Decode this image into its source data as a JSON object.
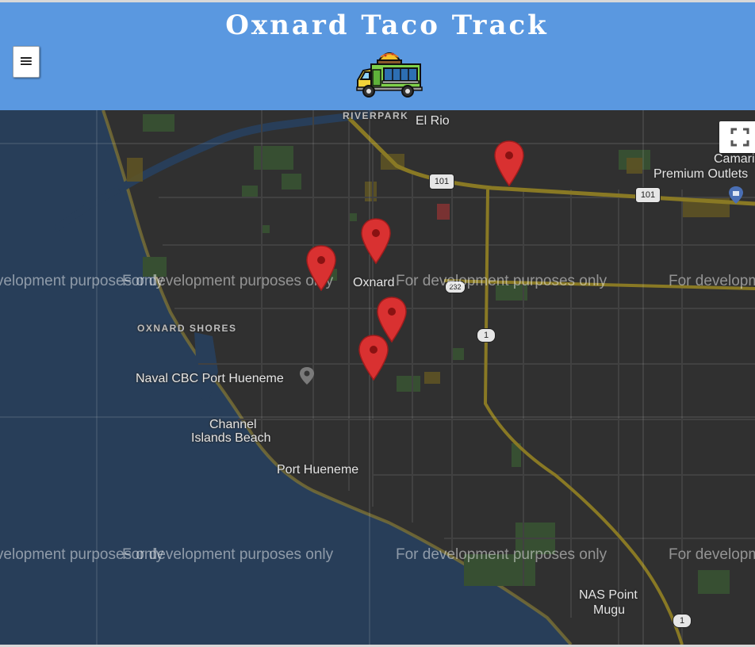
{
  "app": {
    "title": "Oxnard Taco Track",
    "menu_icon": "hamburger-icon",
    "logo_icon": "taco-truck-icon"
  },
  "colors": {
    "header": "#5a98e0",
    "ocean": "#2e4766",
    "land": "#363636",
    "pin": "#d93131",
    "highway": "#9c8a2a"
  },
  "map": {
    "watermark": "For development purposes only",
    "fullscreen_icon": "fullscreen-icon",
    "labels": {
      "riverpark": "RIVERPARK",
      "el_rio": "El Rio",
      "camarillo": "Camarillo",
      "premium_outlets": "Premium Outlets",
      "oxnard": "Oxnard",
      "oxnard_shores": "OXNARD SHORES",
      "naval_cbc": "Naval CBC Port Hueneme",
      "channel_islands_1": "Channel",
      "channel_islands_2": "Islands Beach",
      "port_hueneme": "Port Hueneme",
      "nas_point_1": "NAS Point",
      "nas_point_2": "Mugu"
    },
    "shields": {
      "us101_a": "101",
      "us101_b": "101",
      "ca1_a": "1",
      "ca1_b": "1",
      "ca232": "232"
    },
    "markers": [
      {
        "name": "food-truck-marker-1"
      },
      {
        "name": "food-truck-marker-2"
      },
      {
        "name": "food-truck-marker-3"
      },
      {
        "name": "food-truck-marker-4"
      },
      {
        "name": "food-truck-marker-5"
      }
    ]
  }
}
